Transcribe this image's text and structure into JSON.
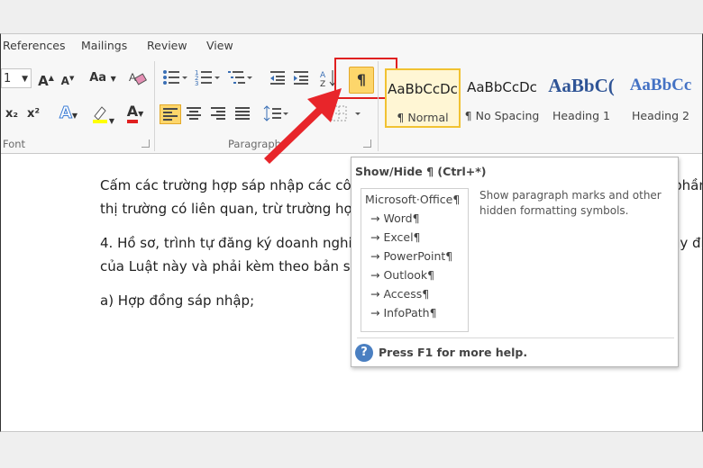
{
  "tabs": [
    "References",
    "Mailings",
    "Review",
    "View"
  ],
  "font_group": {
    "size_fragment": "1",
    "grow_label": "A",
    "shrink_label": "A",
    "case_label": "Aa",
    "subscript_label": "x₂",
    "superscript_label": "x²",
    "font_color_label": "A",
    "label": "Font"
  },
  "paragraph_group": {
    "label": "Paragraph",
    "show_hide_label": "¶"
  },
  "styles": [
    {
      "sample": "AaBbCcDc",
      "name": "¶ Normal"
    },
    {
      "sample": "AaBbCcDc",
      "name": "¶ No Spacing"
    },
    {
      "sample": "AaBbC(",
      "name": "Heading 1"
    },
    {
      "sample": "AaBbCc",
      "name": "Heading 2"
    }
  ],
  "document": {
    "paragraphs": [
      "Cấm các trường hợp sáp nhập các công ty mà theo đó công ty nhận sáp nhập có thị phần",
      "thị trường có liên quan, trừ trường hợp Luật cạnh tranh năm",
      "4. Hồ sơ, trình tự đăng ký doanh nghiệp công ty nhận sáp nhập thực hiện theo các quy đị",
      "của Luật này và phải kèm theo bản sao các giấy tờ sau đây:",
      "a) Hợp đồng sáp nhập;"
    ]
  },
  "tooltip": {
    "title": "Show/Hide ¶ (Ctrl+*)",
    "description": "Show paragraph marks and other hidden formatting symbols.",
    "preview_lines": [
      "Microsoft·Office¶",
      "→ Word¶",
      "→ Excel¶",
      "→ PowerPoint¶",
      "→ Outlook¶",
      "→ Access¶",
      "→ InfoPath¶"
    ],
    "help_icon": "?",
    "help_text": "Press F1 for more help."
  },
  "colors": {
    "highlight_red": "#e02020",
    "active_button": "#fdd66b",
    "arrow_red": "#e8252a"
  }
}
